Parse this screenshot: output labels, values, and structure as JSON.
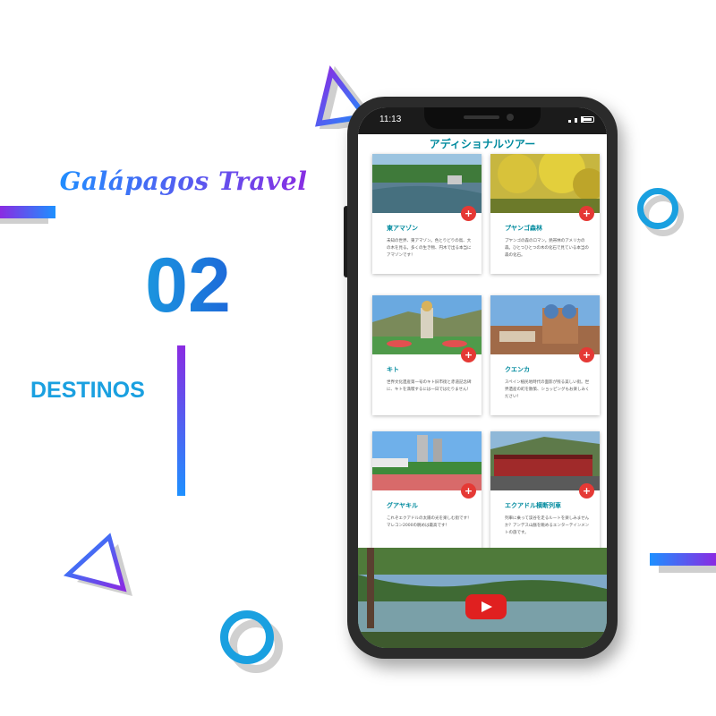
{
  "brand": "Galápagos Travel",
  "number": "02",
  "section": "DESTINOS",
  "phone": {
    "time": "11:13",
    "page_title": "アディショナルツアー",
    "cards": [
      {
        "title": "東アマゾン",
        "text": "未知の世界、東アマゾン。色とりどりの鳥、大の木を見る。多くの生き物、円木で出る本当にアマゾンです！"
      },
      {
        "title": "プヤンゴ森林",
        "text": "プヤンゴの森のロマン。熱帯林のアメリカの森。ひとつひとつの木の化石で見ている本当の森の化石。"
      },
      {
        "title": "キト",
        "text": "世界文化遺産第一号のキト旧市街と赤道記念碑に、キトを満喫するには一日ではたりません！"
      },
      {
        "title": "クエンカ",
        "text": "スペイン植民地時代の面影が残る美しい街。世界遺産の町を散策、ショッピングもお楽しみください！"
      },
      {
        "title": "グアヤキル",
        "text": "これぞエクアドルの太陽の光を楽しむ街です！マレコン2000の眺めは最高です！"
      },
      {
        "title": "エクアドル横断列車",
        "text": "列車に乗って渓谷を走るルートを楽しみませんか？アンデス山脈を眺めるエンターテインメントの旅です。"
      }
    ],
    "video_icon": "youtube-play-icon"
  },
  "colors": {
    "accent_blue": "#1aa0e0",
    "accent_purple": "#8a2be2",
    "teal_title": "#008a9e",
    "plus_red": "#e53935"
  }
}
